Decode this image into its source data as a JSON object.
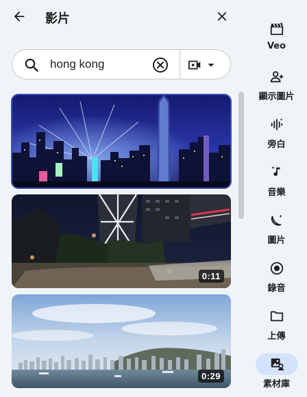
{
  "header": {
    "title": "影片",
    "back_icon": "arrow-left-icon",
    "close_icon": "close-icon"
  },
  "search": {
    "value": "hong kong",
    "placeholder": "",
    "search_icon": "search-icon",
    "clear_icon": "clear-circle-icon",
    "media_type_icon": "video-camera-icon",
    "dropdown_icon": "caret-down-icon"
  },
  "results": [
    {
      "subject": "Hong Kong skyline at night with laser light show",
      "duration": "",
      "selected": true
    },
    {
      "subject": "Hong Kong Bank of China tower street at night",
      "duration": "0:11",
      "selected": false
    },
    {
      "subject": "Hong Kong harbour skyline by day",
      "duration": "0:29",
      "selected": false
    }
  ],
  "rail": {
    "items": [
      {
        "label": "Veo",
        "icon": "clapperboard-icon",
        "active": false
      },
      {
        "label": "顯示圖片",
        "icon": "person-add-icon",
        "active": false
      },
      {
        "label": "旁白",
        "icon": "voice-wave-icon",
        "active": false
      },
      {
        "label": "音樂",
        "icon": "music-note-icon",
        "active": false
      },
      {
        "label": "圖片",
        "icon": "banana-sparkle-icon",
        "active": false
      },
      {
        "label": "錄音",
        "icon": "record-icon",
        "active": false
      },
      {
        "label": "上傳",
        "icon": "folder-icon",
        "active": false
      },
      {
        "label": "素材庫",
        "icon": "media-library-icon",
        "active": true
      }
    ]
  },
  "colors": {
    "background": "#f0f4f9",
    "active_pill": "#d3e3fd",
    "selected_outline": "#3a4fb8"
  }
}
